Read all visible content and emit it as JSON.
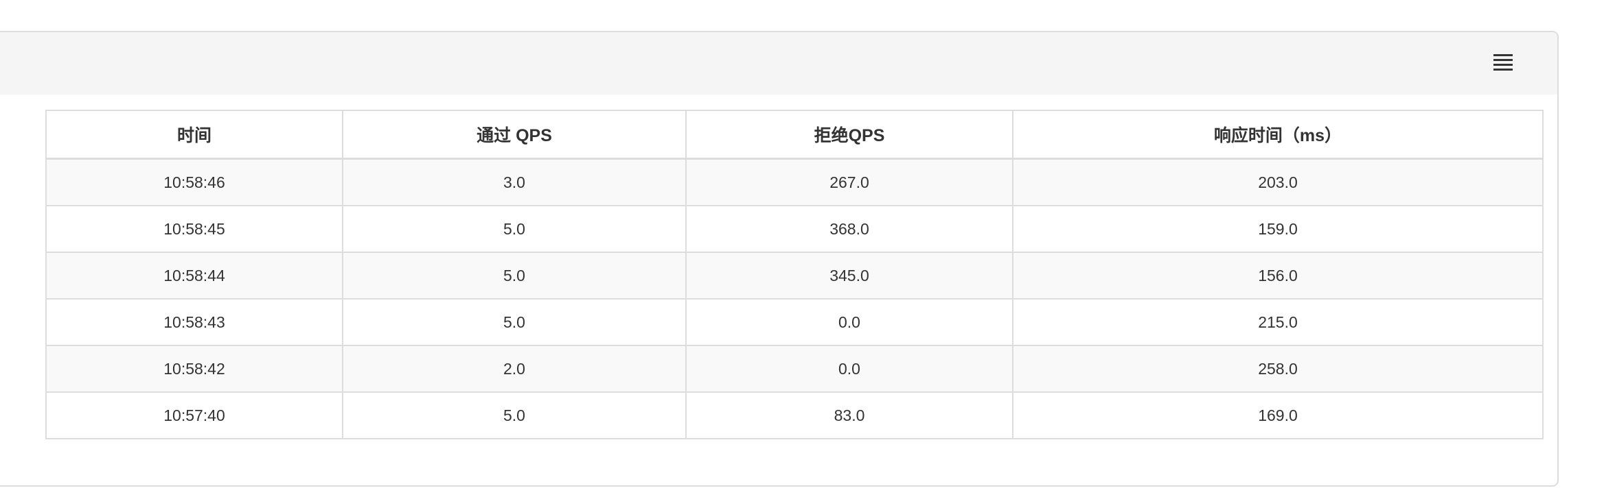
{
  "table": {
    "columns": [
      "时间",
      "通过 QPS",
      "拒绝QPS",
      "响应时间（ms）"
    ],
    "rows": [
      [
        "10:58:46",
        "3.0",
        "267.0",
        "203.0"
      ],
      [
        "10:58:45",
        "5.0",
        "368.0",
        "159.0"
      ],
      [
        "10:58:44",
        "5.0",
        "345.0",
        "156.0"
      ],
      [
        "10:58:43",
        "5.0",
        "0.0",
        "215.0"
      ],
      [
        "10:58:42",
        "2.0",
        "0.0",
        "258.0"
      ],
      [
        "10:57:40",
        "5.0",
        "83.0",
        "169.0"
      ]
    ]
  },
  "header": {
    "menu_icon": "hamburger-menu-icon"
  }
}
